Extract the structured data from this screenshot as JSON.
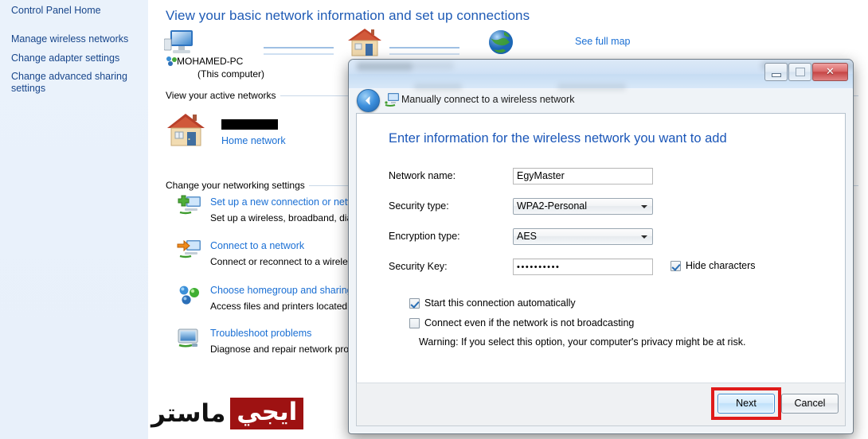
{
  "sidebar": {
    "home_label": "Control Panel Home",
    "items": [
      {
        "label": "Manage wireless networks"
      },
      {
        "label": "Change adapter settings"
      },
      {
        "label": "Change advanced sharing settings"
      }
    ]
  },
  "main": {
    "page_title": "View your basic network information and set up connections",
    "see_full_map": "See full map",
    "computer_name": "MOHAMED-PC",
    "computer_sub": "(This computer)",
    "active_networks_heading": "View your active networks",
    "active_network_name": "",
    "active_network_type": "Home network",
    "change_settings_heading": "Change your networking settings",
    "settings": [
      {
        "title": "Set up a new connection or netw",
        "desc": "Set up a wireless, broadband, dia",
        "icon": "new-connection-icon"
      },
      {
        "title": "Connect to a network",
        "desc": "Connect or reconnect to a wirele",
        "icon": "connect-network-icon"
      },
      {
        "title": "Choose homegroup and sharing",
        "desc": "Access files and printers located",
        "icon": "homegroup-icon"
      },
      {
        "title": "Troubleshoot problems",
        "desc": "Diagnose and repair network pro",
        "icon": "troubleshoot-icon"
      }
    ]
  },
  "watermark": {
    "boxed_text": "ايجي",
    "plain_text": "ماستر",
    "box_color": "#9e1212"
  },
  "dialog": {
    "wizard_title": "Manually connect to a wireless network",
    "wizard_icon": "wireless-network-icon",
    "back_icon": "back-arrow-icon",
    "window_buttons": {
      "minimize": "minimize-icon",
      "maximize": "maximize-icon",
      "close": "✕"
    },
    "heading": "Enter information for the wireless network you want to add",
    "fields": [
      {
        "label": "Network name:",
        "value": "EgyMaster",
        "kind": "text"
      },
      {
        "label": "Security type:",
        "value": "WPA2-Personal",
        "kind": "combo"
      },
      {
        "label": "Encryption type:",
        "value": "AES",
        "kind": "combo"
      },
      {
        "label": "Security Key:",
        "value": "••••••••••",
        "kind": "password"
      }
    ],
    "checkboxes": [
      {
        "label": "Hide characters",
        "checked": true
      },
      {
        "label": "Start this connection automatically",
        "checked": true
      },
      {
        "label": "Connect even if the network is not broadcasting",
        "checked": false
      }
    ],
    "warning": "Warning: If you select this option, your computer's privacy might be at risk.",
    "buttons": {
      "next": "Next",
      "cancel": "Cancel"
    },
    "highlight_color": "#e01b1b"
  }
}
